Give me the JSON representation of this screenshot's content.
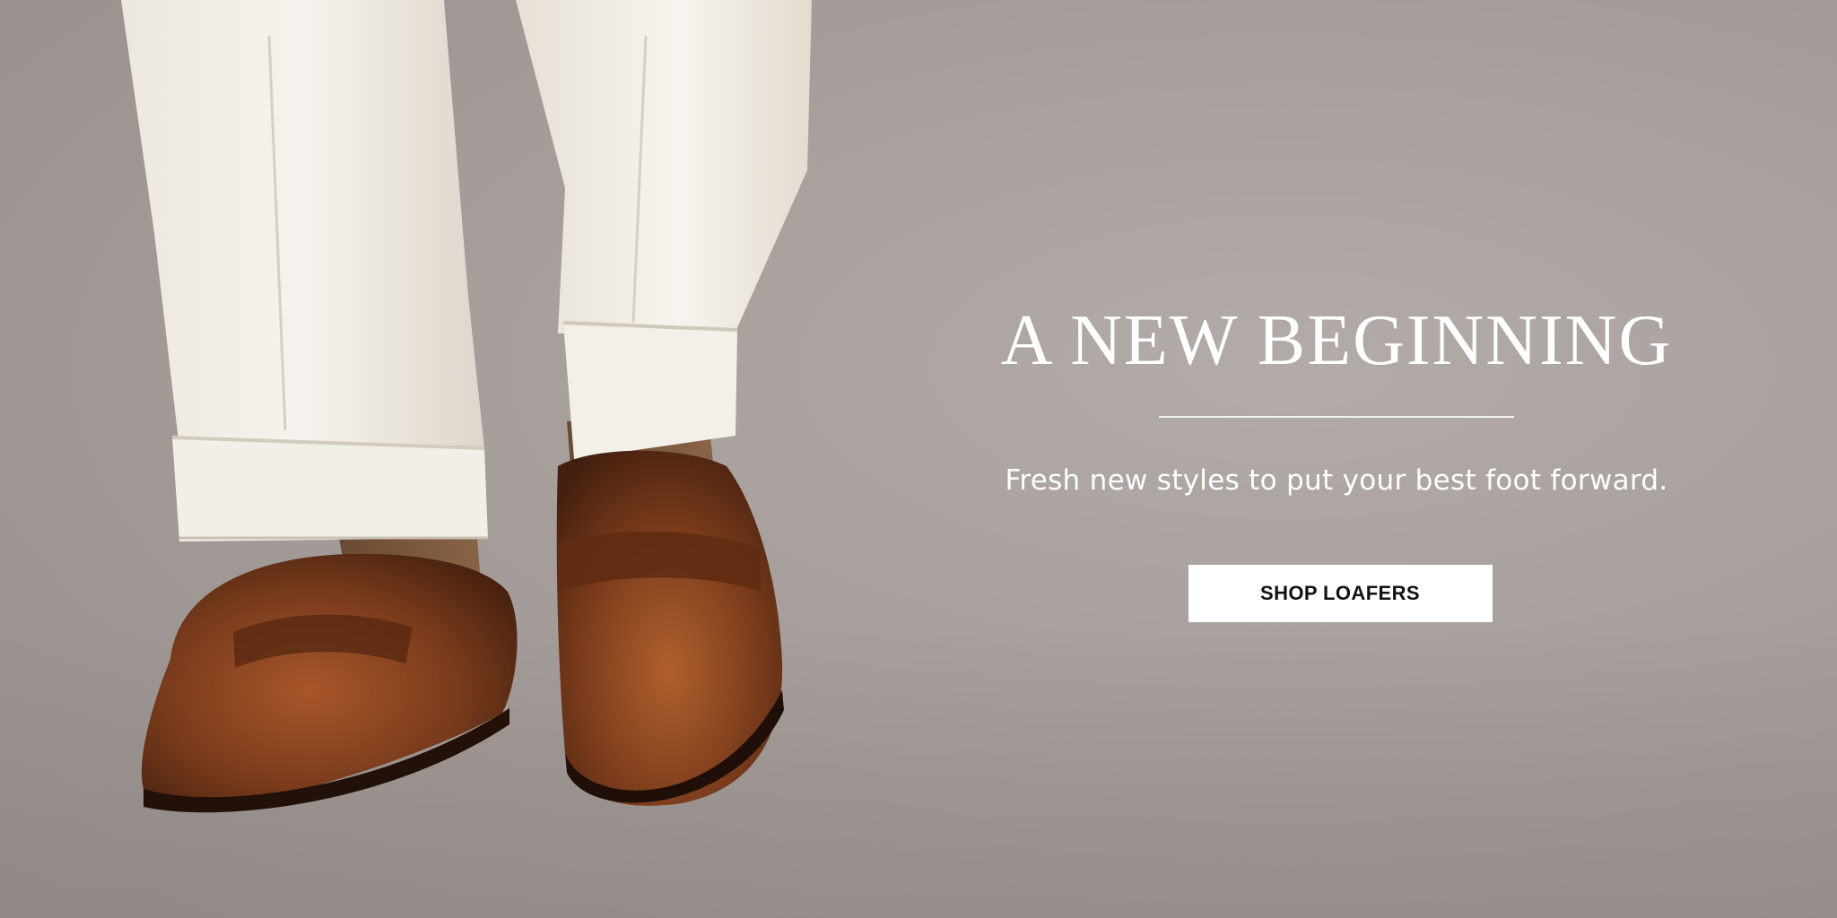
{
  "hero": {
    "title": "A NEW BEGINNING",
    "subtitle": "Fresh new styles to put your best foot forward.",
    "cta_label": "SHOP LOAFERS"
  },
  "colors": {
    "background": "#a69e9a",
    "trousers": "#f1ede6",
    "loafer": "#7a3e1d",
    "button_bg": "#ffffff",
    "button_text": "#111111",
    "text": "#ffffff"
  }
}
